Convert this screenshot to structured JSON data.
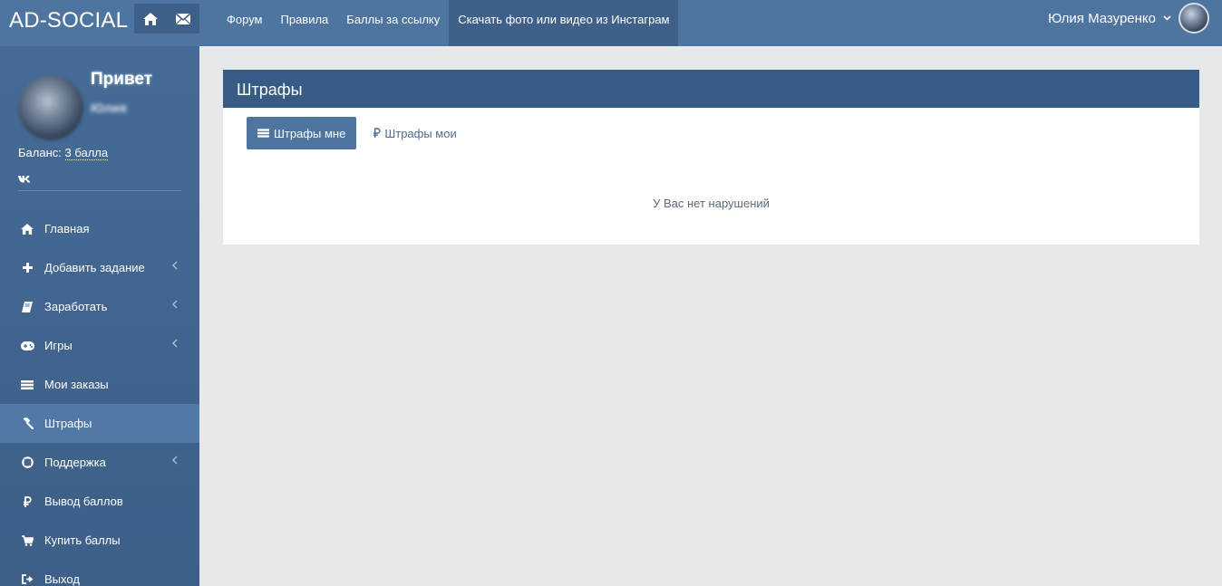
{
  "header": {
    "brand": "AD-SOCIAL",
    "nav": [
      {
        "label": "Форум"
      },
      {
        "label": "Правила"
      },
      {
        "label": "Баллы за ссылку"
      },
      {
        "label": "Скачать фото или видео из Инстаграм"
      }
    ],
    "user_name": "Юлия Мазуренко",
    "icons": {
      "home": "home-icon",
      "mail": "envelope-icon",
      "dropdown": "chevron-down-icon"
    }
  },
  "sidebar": {
    "greeting": "Привет",
    "name": "Юлия",
    "balance_label": "Баланс:",
    "balance_value": "3 балла",
    "social_icon": "vk-icon",
    "items": [
      {
        "label": "Главная",
        "icon": "home-icon",
        "submenu": false
      },
      {
        "label": "Добавить задание",
        "icon": "plus-icon",
        "submenu": true
      },
      {
        "label": "Заработать",
        "icon": "book-icon",
        "submenu": true
      },
      {
        "label": "Игры",
        "icon": "gamepad-icon",
        "submenu": true
      },
      {
        "label": "Мои заказы",
        "icon": "list-icon",
        "submenu": false
      },
      {
        "label": "Штрафы",
        "icon": "gavel-icon",
        "submenu": false,
        "active": true
      },
      {
        "label": "Поддержка",
        "icon": "lifebuoy-icon",
        "submenu": true
      },
      {
        "label": "Вывод баллов",
        "icon": "ruble-icon",
        "submenu": false
      },
      {
        "label": "Купить баллы",
        "icon": "cart-icon",
        "submenu": false
      },
      {
        "label": "Выход",
        "icon": "sign-out-icon",
        "submenu": false
      }
    ]
  },
  "main": {
    "title": "Штрафы",
    "tabs": [
      {
        "label": "Штрафы мне",
        "active": true
      },
      {
        "label": "Штрафы мои",
        "active": false
      }
    ],
    "empty_message": "У Вас нет нарушений"
  },
  "colors": {
    "topbar": "#4e74a0",
    "sidebar": "#456b96",
    "panel_header": "#375b85",
    "active_item": "#5079a6",
    "background": "#e6e9ec"
  }
}
